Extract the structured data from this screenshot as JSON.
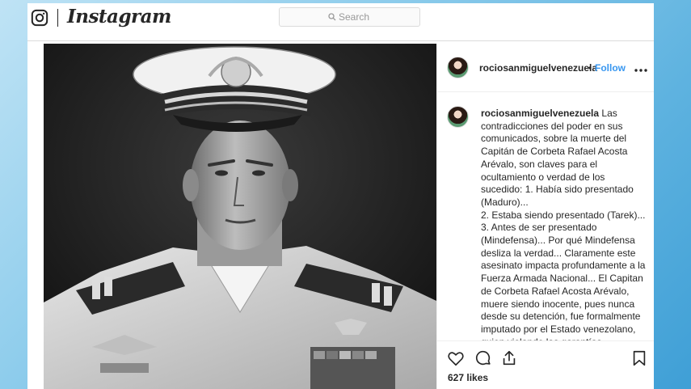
{
  "app": {
    "name": "Instagram",
    "brand_color": "#262626",
    "link_color": "#3897f0"
  },
  "search": {
    "placeholder": "Search",
    "icon": "magnifier-icon"
  },
  "post": {
    "photo_subject": "naval officer portrait",
    "username": "rociosanmiguelvenezuela",
    "separator": "•",
    "follow_label": "Follow",
    "more_icon": "ellipsis-icon",
    "caption_author": "rociosanmiguelvenezuela",
    "caption_text": "Las contradicciones del poder en sus comunicados, sobre la muerte del Capitán de Corbeta Rafael Acosta Arévalo, son claves para el ocultamiento o verdad de los sucedido: 1. Había sido presentado (Maduro)...\n2. Estaba siendo presentado (Tarek)...\n3. Antes de ser presentado (Mindefensa)... Por qué Mindefensa desliza la verdad... Claramente este asesinato impacta profundamente a la Fuerza Armada Nacional... El Capitan de Corbeta Rafael Acosta Arévalo, muere siendo inocente, pues nunca desde su detención, fue formalmente imputado por el Estado venezolano, quien violando las garantías constitucionales mas elementales del",
    "likes": "627 likes",
    "action_icons": [
      "heart-icon",
      "comment-icon",
      "share-icon",
      "bookmark-icon"
    ]
  }
}
